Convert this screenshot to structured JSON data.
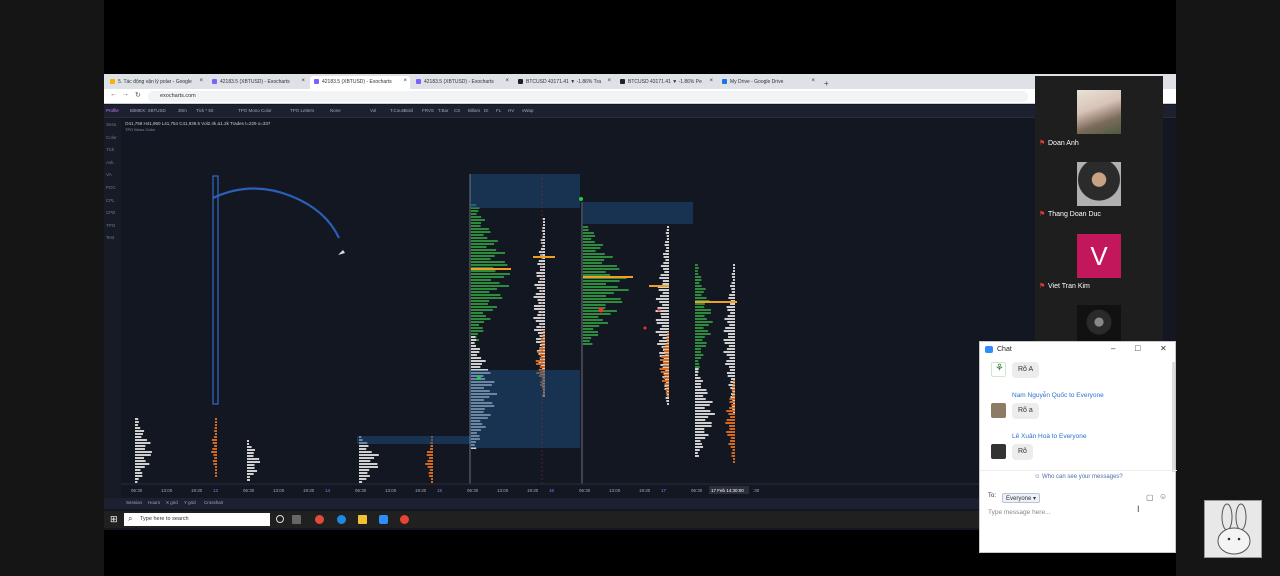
{
  "browser": {
    "tabs": [
      {
        "label": "5. Tác động vận lý polar - Google",
        "color": "#f4b400"
      },
      {
        "label": "42183.5 (XBTUSD) - Exocharts",
        "color": "#7b61ff"
      },
      {
        "label": "42183.5 (XBTUSD) - Exocharts",
        "color": "#7b61ff"
      },
      {
        "label": "42183.5 (XBTUSD) - Exocharts",
        "color": "#7b61ff"
      },
      {
        "label": "BTCUSD 43171.41 ▼ -1.86% Tra",
        "color": "#222222"
      },
      {
        "label": "BTCUSD 43171.41 ▼ -1.86% Pe",
        "color": "#222222"
      },
      {
        "label": "My Drive - Google Drive",
        "color": "#1a73e8"
      }
    ],
    "new_tab": "+",
    "url": "exocharts.com"
  },
  "app": {
    "toolbar": [
      "Profile",
      "BitMEX: XBTUSD",
      "30m",
      "Tick * 50",
      "TPO Mono Color",
      "TPO Letters",
      "None",
      "Vol",
      "T.Count",
      "Bold",
      "FRVS",
      "T.Bar",
      "CS",
      "Billars",
      "DI",
      "FL",
      "HV",
      "vWap"
    ],
    "info_line": "O41,758 H41,960 L41,754 C41,939.5  Vol2.4k  Δ1.2k  Trades t=229 o=337",
    "info_sub": "TPO Mono Color",
    "left_labels": [
      "Sess.",
      "Color",
      "Tick",
      "Avk.",
      "VA",
      "POC",
      "CPL",
      "CPB",
      "TPO",
      "Text"
    ],
    "time_axis": [
      "06:30",
      "13:00",
      "19:30",
      "13",
      "06:30",
      "13:00",
      "19:30",
      "14",
      "06:30",
      "13:00",
      "19:30",
      "15",
      "06:30",
      "13:00",
      "19:30",
      "16",
      "06:30",
      "13:00",
      "19:30",
      "17",
      "06:30",
      "17 Feb 14:30:00",
      ":30"
    ],
    "status": [
      "Session",
      "Hours",
      "X grid",
      "Y grid",
      "Crosshair"
    ]
  },
  "taskbar": {
    "search_placeholder": "Type here to search"
  },
  "participants": [
    {
      "name": "Doan Anh"
    },
    {
      "name": "Thang Doan Duc"
    },
    {
      "name": "Viet Tran Kim",
      "initial": "V"
    }
  ],
  "chat": {
    "title": "Chat",
    "messages": [
      {
        "sender": "",
        "text": "Rõ A"
      },
      {
        "sender": "Nam Nguyễn Quốc to Everyone",
        "text": "Rõ a"
      },
      {
        "sender": "Lê Xuân Hoà to Everyone",
        "text": "Rõ"
      }
    ],
    "who_can_see": "Who can see your messages?",
    "to_label": "To:",
    "to_value": "Everyone",
    "input_placeholder": "Type message here..."
  }
}
